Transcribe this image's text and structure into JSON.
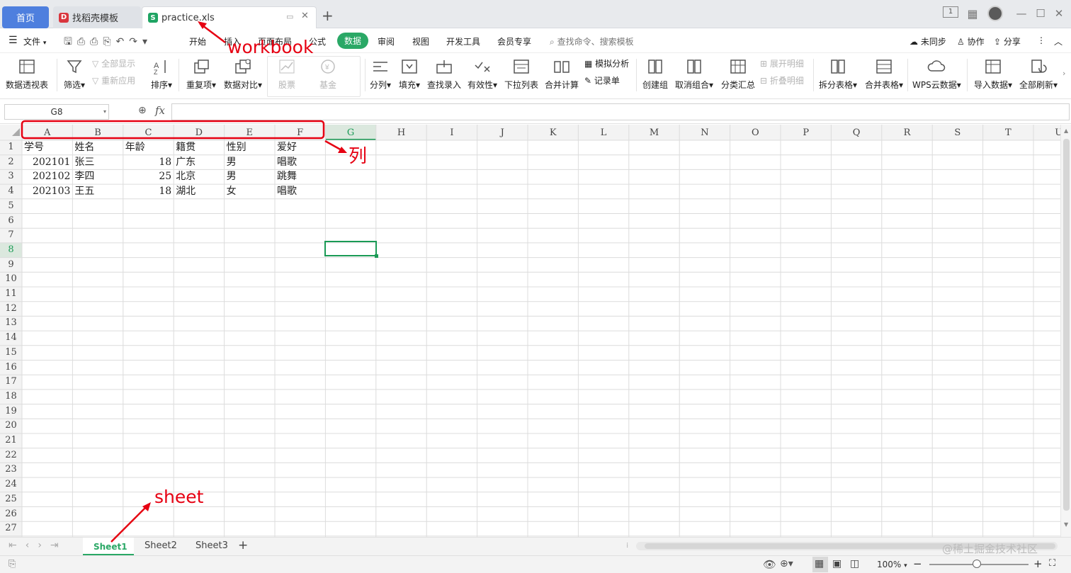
{
  "titlebar": {
    "home_tab": "首页",
    "dao_tab": "找稻壳模板",
    "file_tab": "practice.xls",
    "add_tab": "+",
    "win_one": "1",
    "min": "—",
    "max": "☐",
    "close": "✕"
  },
  "menubar": {
    "file_label": "文件",
    "items": [
      "开始",
      "插入",
      "页面布局",
      "公式",
      "数据",
      "审阅",
      "视图",
      "开发工具",
      "会员专享"
    ],
    "search_placeholder": "查找命令、搜索模板",
    "sync": "未同步",
    "collab": "协作",
    "share": "分享"
  },
  "ribbon": {
    "pivot": "数据透视表",
    "filter": "筛选",
    "show_all": "全部显示",
    "reapply": "重新应用",
    "sort": "排序",
    "dup": "重复项",
    "compare": "数据对比",
    "stock": "股票",
    "fund": "基金",
    "split": "分列",
    "fill": "填充",
    "lookup": "查找录入",
    "validity": "有效性",
    "dropdown": "下拉列表",
    "consolidate": "合并计算",
    "simulate": "模拟分析",
    "records": "记录单",
    "group": "创建组",
    "ungroup": "取消组合",
    "subtotal": "分类汇总",
    "expand": "展开明细",
    "collapse": "折叠明细",
    "split_table": "拆分表格",
    "merge_table": "合并表格",
    "wps_cloud": "WPS云数据",
    "import": "导入数据",
    "refresh_all": "全部刷新"
  },
  "formula_bar": {
    "name_box": "G8",
    "fx": "fx",
    "value": ""
  },
  "grid": {
    "columns": [
      "A",
      "B",
      "C",
      "D",
      "E",
      "F",
      "G",
      "H",
      "I",
      "J",
      "K",
      "L",
      "M",
      "N",
      "O",
      "P",
      "Q",
      "R",
      "S",
      "T",
      "U"
    ],
    "rows": [
      "1",
      "2",
      "3",
      "4",
      "5",
      "6",
      "7",
      "8",
      "9",
      "10",
      "11",
      "12",
      "13",
      "14",
      "15",
      "16",
      "17",
      "18",
      "19",
      "20",
      "21",
      "22",
      "23",
      "24",
      "25",
      "26",
      "27"
    ],
    "header": [
      "学号",
      "姓名",
      "年龄",
      "籍贯",
      "性别",
      "爱好"
    ],
    "data": [
      [
        "202101",
        "张三",
        "18",
        "广东",
        "男",
        "唱歌"
      ],
      [
        "202102",
        "李四",
        "25",
        "北京",
        "男",
        "跳舞"
      ],
      [
        "202103",
        "王五",
        "18",
        "湖北",
        "女",
        "唱歌"
      ]
    ],
    "active_cell": "G8"
  },
  "sheets": {
    "tabs": [
      "Sheet1",
      "Sheet2",
      "Sheet3"
    ],
    "active": "Sheet1",
    "add": "+"
  },
  "status": {
    "zoom": "100%",
    "watermark": "@稀土掘金技术社区"
  },
  "annotations": {
    "workbook": "workbook",
    "column": "列",
    "sheet": "sheet",
    "color": "#e60012"
  },
  "colors": {
    "accent": "#2aa866",
    "home_tab": "#4e7fde",
    "selection": "#1a9a55"
  }
}
